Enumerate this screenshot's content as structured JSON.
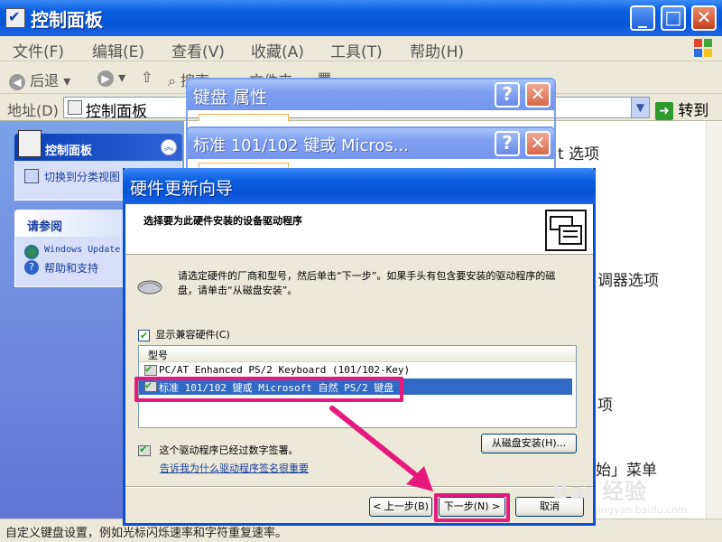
{
  "window": {
    "title": "控制面板",
    "menu": [
      "文件(F)",
      "编辑(E)",
      "查看(V)",
      "收藏(A)",
      "工具(T)",
      "帮助(H)"
    ],
    "toolbar": {
      "back": "后退",
      "search": "搜索",
      "folders": "文件夹"
    },
    "address_label": "地址(D)",
    "address_value": "控制面板",
    "go_label": "转到"
  },
  "left_pane": {
    "panel1_title": "控制面板",
    "switch_view": "切换到分类视图",
    "panel2_title": "请参阅",
    "windows_update": "Windows Update",
    "help_support": "帮助和支持"
  },
  "right_pane": {
    "frag1": "t 选项",
    "frag2": "调器选项",
    "frag3": "项",
    "frag4": "始」菜单"
  },
  "status_text": "自定义键盘设置，例如光标闪烁速率和字符重复速率。",
  "dialogs": {
    "keyboard_props": "键盘 属性",
    "device_props": "标准 101/102 键或 Micros..."
  },
  "wizard": {
    "title": "硬件更新向导",
    "heading": "选择要为此硬件安装的设备驱动程序",
    "instruction": "请选定硬件的厂商和型号，然后单击“下一步”。如果手头有包含要安装的驱动程序的磁盘，请单击“从磁盘安装”。",
    "show_compatible": "显示兼容硬件(C)",
    "model_header": "型号",
    "models": [
      "PC/AT Enhanced PS/2 Keyboard (101/102-Key)",
      "标准 101/102 键或 Microsoft 自然 PS/2 键盘"
    ],
    "signed_text": "这个驱动程序已经过数字签署。",
    "signed_link": "告诉我为什么驱动程序签名很重要",
    "disk_button": "从磁盘安装(H)...",
    "back_button": "< 上一步(B)",
    "next_button": "下一步(N) >",
    "cancel_button": "取消"
  },
  "watermark": "Bai 经验",
  "watermark_sub": "jingyan.baidu.com",
  "colors": {
    "xp_blue": "#0a5ee0",
    "highlight_pink": "#e6197d",
    "selection": "#316ac5"
  }
}
